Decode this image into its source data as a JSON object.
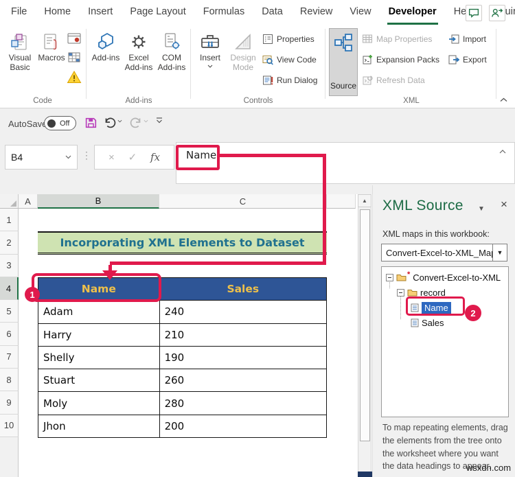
{
  "menubar": {
    "tabs": [
      {
        "label": "File"
      },
      {
        "label": "Home"
      },
      {
        "label": "Insert"
      },
      {
        "label": "Page Layout"
      },
      {
        "label": "Formulas"
      },
      {
        "label": "Data"
      },
      {
        "label": "Review"
      },
      {
        "label": "View"
      },
      {
        "label": "Developer",
        "active": true
      },
      {
        "label": "Help"
      },
      {
        "label": "Inquire"
      }
    ]
  },
  "ribbon": {
    "code": {
      "vb": "Visual Basic",
      "macros": "Macros",
      "group": "Code"
    },
    "addins": {
      "addins": "Add-ins",
      "excel": "Excel Add-ins",
      "com": "COM Add-ins",
      "group": "Add-ins"
    },
    "controls": {
      "insert": "Insert",
      "design": "Design Mode",
      "properties": "Properties",
      "view_code": "View Code",
      "run_dialog": "Run Dialog",
      "group": "Controls"
    },
    "xml": {
      "source": "Source",
      "map_properties": "Map Properties",
      "expansion_packs": "Expansion Packs",
      "refresh_data": "Refresh Data",
      "import": "Import",
      "export": "Export",
      "group": "XML"
    }
  },
  "qat": {
    "autosave": "AutoSave",
    "off": "Off"
  },
  "formula": {
    "cell_ref": "B4",
    "value": "Name"
  },
  "glyphs": {
    "up": "▲",
    "down": "▼",
    "close": "×",
    "check": "✓",
    "cancel": "×",
    "dots": "⋮",
    "fx": "fx",
    "asterisk": "*"
  },
  "sheet": {
    "col_headers": [
      "A",
      "B",
      "C"
    ],
    "row_headers": [
      "1",
      "2",
      "3",
      "4",
      "5",
      "6",
      "7",
      "8",
      "9",
      "10"
    ],
    "title": "Incorporating XML Elements to Dataset",
    "table": {
      "headers": [
        "Name",
        "Sales"
      ],
      "rows": [
        [
          "Adam",
          "240"
        ],
        [
          "Harry",
          "210"
        ],
        [
          "Shelly",
          "190"
        ],
        [
          "Stuart",
          "260"
        ],
        [
          "Moly",
          "280"
        ],
        [
          "Jhon",
          "200"
        ]
      ]
    }
  },
  "pane": {
    "title": "XML Source",
    "maps_label": "XML maps in this workbook:",
    "map_name": "Convert-Excel-to-XML_Map",
    "tree": {
      "root": "Convert-Excel-to-XML",
      "record": "record",
      "name": "Name",
      "sales": "Sales"
    },
    "instruction": "To map repeating elements, drag the elements from the tree onto the worksheet where you want the data headings to appear.",
    "watermark": "wsxdn.com"
  },
  "annotations": {
    "step1": "1",
    "step2": "2"
  },
  "colors": {
    "accent_green": "#1e7145",
    "header_blue": "#2e5596",
    "header_gold": "#eec04a",
    "title_bg": "#cfe3b2",
    "title_text": "#20718f",
    "annotation_red": "#e01a4c",
    "tree_selection_blue": "#2e68c0",
    "pane_title_green": "#1d6b45",
    "save_magenta": "#b83dba"
  }
}
